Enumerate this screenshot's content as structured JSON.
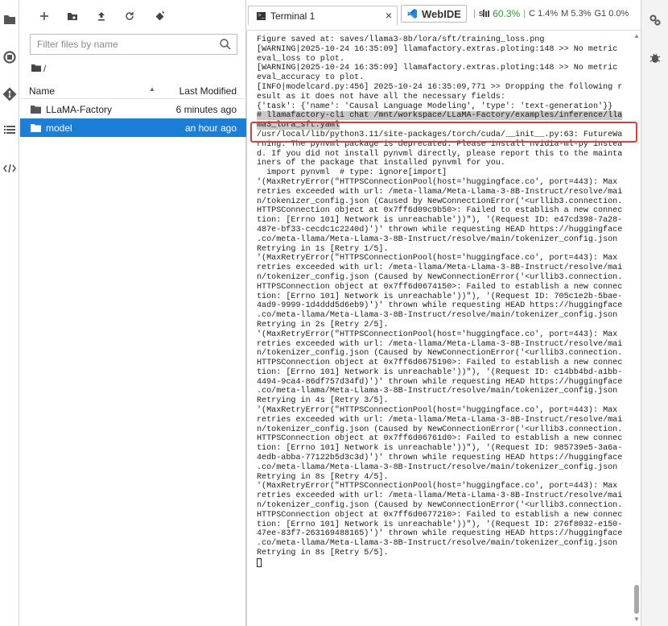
{
  "filebrowser": {
    "search_placeholder": "Filter files by name",
    "breadcrumb": "/",
    "header_name": "Name",
    "header_modified": "Last Modified",
    "sort_indicator": "▲",
    "items": [
      {
        "name": "LLaMA-Factory",
        "modified": "6 minutes ago"
      },
      {
        "name": "model",
        "modified": "an hour ago"
      }
    ]
  },
  "tabs": {
    "terminal_label": "Terminal 1",
    "close": "×",
    "webide_label": "WebIDE"
  },
  "metrics": {
    "gpu_label": "S",
    "gpu_value": "60.3%",
    "cpu": "C 1.4%",
    "mem": "M 5.3%",
    "g1": "G1 0.0%",
    "sep": "|"
  },
  "terminal": {
    "lines_before": [
      "Figure saved at: saves/llama3-8b/lora/sft/training_loss.png",
      "[WARNING|2025-10-24 16:35:09] llamafactory.extras.ploting:148 >> No metric",
      "eval_loss to plot.",
      "[WARNING|2025-10-24 16:35:09] llamafactory.extras.ploting:148 >> No metric",
      "eval_accuracy to plot.",
      "[INFO|modelcard.py:456] 2025-10-24 16:35:09,771 >> Dropping the following r",
      "esult as it does not have all the necessary fields:",
      "{'task': {'name': 'Causal Language Modeling', 'type': 'text-generation'}}"
    ],
    "highlighted_command": [
      "# llamafactory-cli chat /mnt/workspace/LLaMA-Factory/examples/inference/lla",
      "ma3_lora_sft.yaml"
    ],
    "lines_after": [
      "/usr/local/lib/python3.11/site-packages/torch/cuda/__init__.py:63: FutureWa",
      "rning: The pynvml package is deprecated. Please install nvidia-ml-py instea",
      "d. If you did not install pynvml directly, please report this to the mainta",
      "iners of the package that installed pynvml for you.",
      "  import pynvml  # type: ignore[import]",
      "'(MaxRetryError(\"HTTPSConnectionPool(host='huggingface.co', port=443): Max",
      "retries exceeded with url: /meta-llama/Meta-Llama-3-8B-Instruct/resolve/mai",
      "n/tokenizer_config.json (Caused by NewConnectionError('<urllib3.connection.",
      "HTTPSConnection object at 0x7ff6d09c9b50>: Failed to establish a new connec",
      "tion: [Errno 101] Network is unreachable'))\"), '(Request ID: e47cd398-7a28-",
      "487e-bf33-cecdc1c2240d)')' thrown while requesting HEAD https://huggingface",
      ".co/meta-llama/Meta-Llama-3-8B-Instruct/resolve/main/tokenizer_config.json",
      "Retrying in 1s [Retry 1/5].",
      "'(MaxRetryError(\"HTTPSConnectionPool(host='huggingface.co', port=443): Max",
      "retries exceeded with url: /meta-llama/Meta-Llama-3-8B-Instruct/resolve/mai",
      "n/tokenizer_config.json (Caused by NewConnectionError('<urllib3.connection.",
      "HTTPSConnection object at 0x7ff6d0674150>: Failed to establish a new connec",
      "tion: [Errno 101] Network is unreachable'))\"), '(Request ID: 705c1e2b-5bae-",
      "4ad9-9999-1d4ddd5d6eb9)')' thrown while requesting HEAD https://huggingface",
      ".co/meta-llama/Meta-Llama-3-8B-Instruct/resolve/main/tokenizer_config.json",
      "Retrying in 2s [Retry 2/5].",
      "'(MaxRetryError(\"HTTPSConnectionPool(host='huggingface.co', port=443): Max",
      "retries exceeded with url: /meta-llama/Meta-Llama-3-8B-Instruct/resolve/mai",
      "n/tokenizer_config.json (Caused by NewConnectionError('<urllib3.connection.",
      "HTTPSConnection object at 0x7ff6d0675190>: Failed to establish a new connec",
      "tion: [Errno 101] Network is unreachable'))\"), '(Request ID: c14bb4bd-a1bb-",
      "4494-9ca4-86df757d34fd)')' thrown while requesting HEAD https://huggingface",
      ".co/meta-llama/Meta-Llama-3-8B-Instruct/resolve/main/tokenizer_config.json",
      "Retrying in 4s [Retry 3/5].",
      "'(MaxRetryError(\"HTTPSConnectionPool(host='huggingface.co', port=443): Max",
      "retries exceeded with url: /meta-llama/Meta-Llama-3-8B-Instruct/resolve/mai",
      "n/tokenizer_config.json (Caused by NewConnectionError('<urllib3.connection.",
      "HTTPSConnection object at 0x7ff6d06761d0>: Failed to establish a new connec",
      "tion: [Errno 101] Network is unreachable'))\"), '(Request ID: 985739e5-3a6a-",
      "4edb-abba-77122b5d3c3d)')' thrown while requesting HEAD https://huggingface",
      ".co/meta-llama/Meta-Llama-3-8B-Instruct/resolve/main/tokenizer_config.json",
      "Retrying in 8s [Retry 4/5].",
      "'(MaxRetryError(\"HTTPSConnectionPool(host='huggingface.co', port=443): Max",
      "retries exceeded with url: /meta-llama/Meta-Llama-3-8B-Instruct/resolve/mai",
      "n/tokenizer_config.json (Caused by NewConnectionError('<urllib3.connection.",
      "HTTPSConnection object at 0x7ff6d0677210>: Failed to establish a new connec",
      "tion: [Errno 101] Network is unreachable'))\"), '(Request ID: 276f8032-e150-",
      "47ee-83f7-263169488165)')' thrown while requesting HEAD https://huggingface",
      ".co/meta-llama/Meta-Llama-3-8B-Instruct/resolve/main/tokenizer_config.json",
      "Retrying in 8s [Retry 5/5]."
    ]
  },
  "colors": {
    "selected_row": "#1c7ed6",
    "highlight_box": "#e03c3c",
    "metric_green": "#2e9b2e"
  },
  "icons": {
    "leftbar": [
      "folder-icon",
      "running-icon",
      "git-icon",
      "list-icon",
      "code-icon"
    ],
    "toolbar": [
      "new-launcher-icon",
      "new-folder-icon",
      "upload-icon",
      "refresh-icon",
      "git-clone-icon"
    ],
    "rightbar": [
      "property-inspector-icon",
      "debugger-icon"
    ]
  }
}
